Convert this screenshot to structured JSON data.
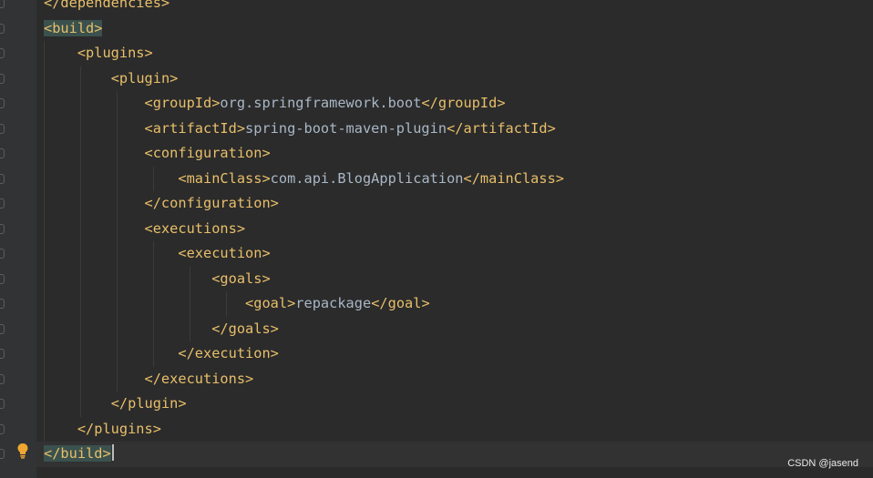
{
  "lines": [
    {
      "indent": 0,
      "open": "</dependencies>",
      "text": "",
      "close": ""
    },
    {
      "indent": 0,
      "open": "<build>",
      "text": "",
      "close": "",
      "highlight": true
    },
    {
      "indent": 1,
      "open": "<plugins>",
      "text": "",
      "close": ""
    },
    {
      "indent": 2,
      "open": "<plugin>",
      "text": "",
      "close": ""
    },
    {
      "indent": 3,
      "open": "<groupId>",
      "text": "org.springframework.boot",
      "close": "</groupId>"
    },
    {
      "indent": 3,
      "open": "<artifactId>",
      "text": "spring-boot-maven-plugin",
      "close": "</artifactId>"
    },
    {
      "indent": 3,
      "open": "<configuration>",
      "text": "",
      "close": ""
    },
    {
      "indent": 4,
      "open": "<mainClass>",
      "text": "com.api.BlogApplication",
      "close": "</mainClass>"
    },
    {
      "indent": 3,
      "open": "</configuration>",
      "text": "",
      "close": ""
    },
    {
      "indent": 3,
      "open": "<executions>",
      "text": "",
      "close": ""
    },
    {
      "indent": 4,
      "open": "<execution>",
      "text": "",
      "close": ""
    },
    {
      "indent": 5,
      "open": "<goals>",
      "text": "",
      "close": ""
    },
    {
      "indent": 6,
      "open": "<goal>",
      "text": "repackage",
      "close": "</goal>"
    },
    {
      "indent": 5,
      "open": "</goals>",
      "text": "",
      "close": ""
    },
    {
      "indent": 4,
      "open": "</execution>",
      "text": "",
      "close": ""
    },
    {
      "indent": 3,
      "open": "</executions>",
      "text": "",
      "close": ""
    },
    {
      "indent": 2,
      "open": "</plugin>",
      "text": "",
      "close": ""
    },
    {
      "indent": 1,
      "open": "</plugins>",
      "text": "",
      "close": ""
    },
    {
      "indent": 0,
      "open": "</build>",
      "text": "",
      "close": "",
      "highlight": true,
      "current": true
    }
  ],
  "watermark": "CSDN @jasend",
  "colors": {
    "background": "#2b2b2b",
    "tag": "#e8bf6a",
    "text": "#a9b7c6",
    "bracket_match": "#3b514d"
  },
  "icons": {
    "intention": "lightbulb-icon"
  }
}
